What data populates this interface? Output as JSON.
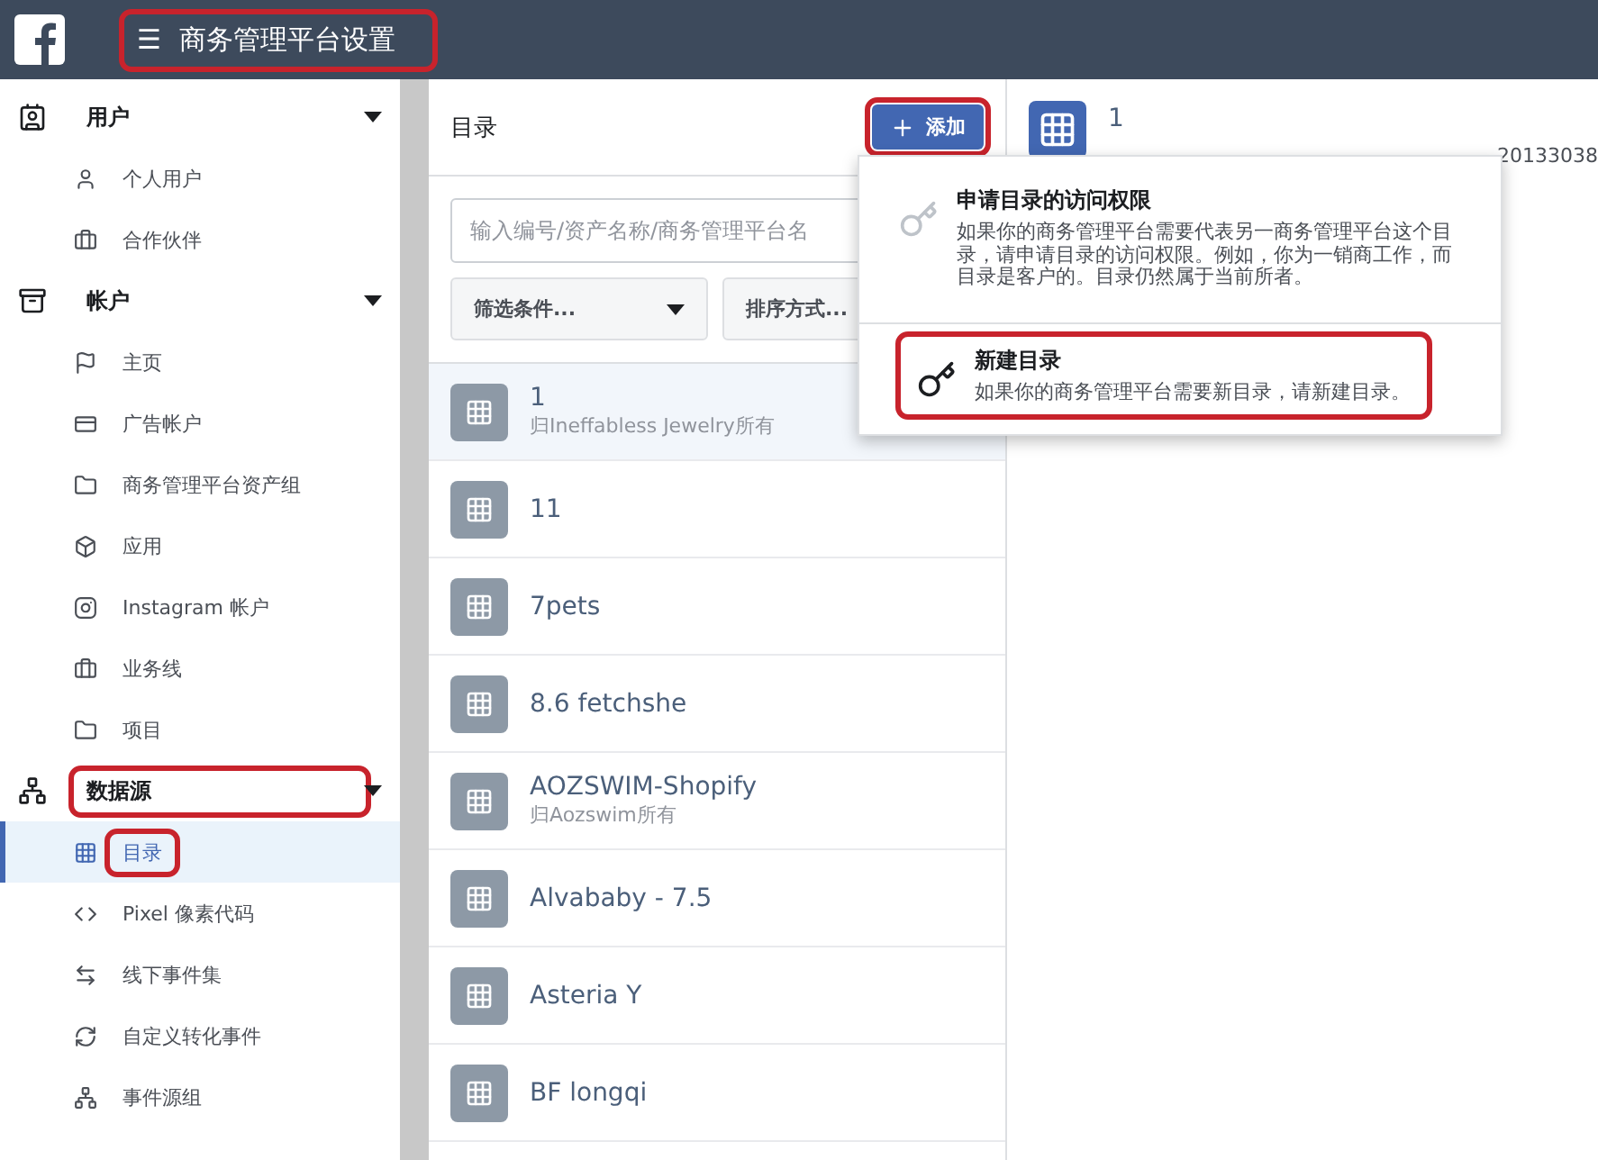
{
  "top_bar": {
    "menu_glyph": "☰",
    "title": "商务管理平台设置",
    "highlighted": true
  },
  "sidebar": {
    "sections": [
      {
        "label": "用户",
        "expanded": true,
        "highlighted": false,
        "children": [
          {
            "label": "个人用户",
            "selected": false,
            "highlighted": false
          },
          {
            "label": "合作伙伴",
            "selected": false,
            "highlighted": false
          }
        ]
      },
      {
        "label": "帐户",
        "expanded": true,
        "highlighted": false,
        "children": [
          {
            "label": "主页",
            "selected": false,
            "highlighted": false
          },
          {
            "label": "广告帐户",
            "selected": false,
            "highlighted": false
          },
          {
            "label": "商务管理平台资产组",
            "selected": false,
            "highlighted": false
          },
          {
            "label": "应用",
            "selected": false,
            "highlighted": false
          },
          {
            "label": "Instagram 帐户",
            "selected": false,
            "highlighted": false
          },
          {
            "label": "业务线",
            "selected": false,
            "highlighted": false
          },
          {
            "label": "项目",
            "selected": false,
            "highlighted": false
          }
        ]
      },
      {
        "label": "数据源",
        "expanded": true,
        "highlighted": true,
        "children": [
          {
            "label": "目录",
            "selected": true,
            "highlighted": true
          },
          {
            "label": "Pixel 像素代码",
            "selected": false,
            "highlighted": false
          },
          {
            "label": "线下事件集",
            "selected": false,
            "highlighted": false
          },
          {
            "label": "自定义转化事件",
            "selected": false,
            "highlighted": false
          },
          {
            "label": "事件源组",
            "selected": false,
            "highlighted": false
          }
        ]
      }
    ]
  },
  "catalog_panel": {
    "title": "目录",
    "add_button": {
      "label": "添加",
      "highlighted": true
    },
    "search": {
      "placeholder": "输入编号/资产名称/商务管理平台名"
    },
    "filter": "筛选条件...",
    "sort": "排序方式...",
    "items": [
      {
        "name": "1",
        "owner": "归Ineffabless Jewelry所有",
        "selected": true
      },
      {
        "name": "11",
        "selected": false
      },
      {
        "name": "7pets",
        "selected": false
      },
      {
        "name": "8.6 fetchshe",
        "selected": false
      },
      {
        "name": "AOZSWIM-Shopify",
        "owner": "归Aozswim所有",
        "selected": false
      },
      {
        "name": "Alvababy - 7.5",
        "selected": false
      },
      {
        "name": "Asteria Y",
        "selected": false
      },
      {
        "name": "BF longqi",
        "selected": false
      }
    ]
  },
  "detail": {
    "title": "1",
    "id_text": "20133038"
  },
  "add_menu": [
    {
      "title": "申请目录的访问权限",
      "description": "如果你的商务管理平台需要代表另一商务管理平台这个目录，请申请目录的访问权限。例如，你为一销商工作，而目录是客户的。目录仍然属于当前所者。",
      "disabled": true,
      "highlighted": false
    },
    {
      "title": "新建目录",
      "description": "如果你的商务管理平台需要新目录，请新建目录。",
      "disabled": false,
      "highlighted": true
    }
  ]
}
